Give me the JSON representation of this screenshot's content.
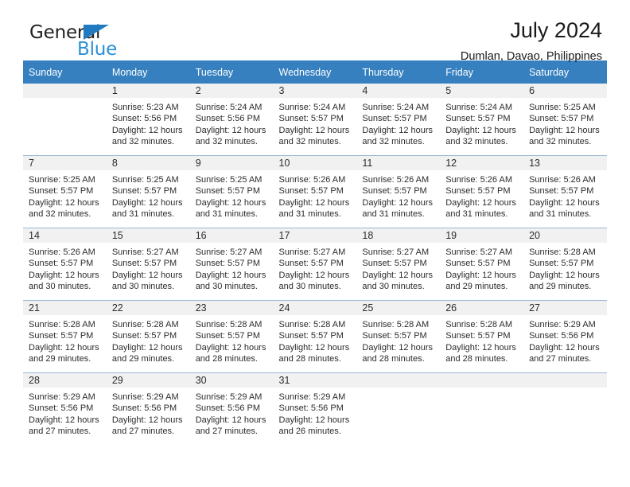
{
  "brand": {
    "name_part1": "General",
    "name_part2": "Blue",
    "triangle_color": "#1f7ac0",
    "text_color": "#2b8fd4"
  },
  "header": {
    "title": "July 2024",
    "subtitle": "Dumlan, Davao, Philippines"
  },
  "theme": {
    "header_bg": "#3680c0",
    "header_text": "#ffffff",
    "daynum_bg": "#f1f1f1",
    "row_divider": "#9cb8d3"
  },
  "weekday_headers": [
    "Sunday",
    "Monday",
    "Tuesday",
    "Wednesday",
    "Thursday",
    "Friday",
    "Saturday"
  ],
  "weeks": [
    [
      {
        "day": "",
        "sunrise": "",
        "sunset": "",
        "daylight_line1": "",
        "daylight_line2": ""
      },
      {
        "day": "1",
        "sunrise": "Sunrise: 5:23 AM",
        "sunset": "Sunset: 5:56 PM",
        "daylight_line1": "Daylight: 12 hours",
        "daylight_line2": "and 32 minutes."
      },
      {
        "day": "2",
        "sunrise": "Sunrise: 5:24 AM",
        "sunset": "Sunset: 5:56 PM",
        "daylight_line1": "Daylight: 12 hours",
        "daylight_line2": "and 32 minutes."
      },
      {
        "day": "3",
        "sunrise": "Sunrise: 5:24 AM",
        "sunset": "Sunset: 5:57 PM",
        "daylight_line1": "Daylight: 12 hours",
        "daylight_line2": "and 32 minutes."
      },
      {
        "day": "4",
        "sunrise": "Sunrise: 5:24 AM",
        "sunset": "Sunset: 5:57 PM",
        "daylight_line1": "Daylight: 12 hours",
        "daylight_line2": "and 32 minutes."
      },
      {
        "day": "5",
        "sunrise": "Sunrise: 5:24 AM",
        "sunset": "Sunset: 5:57 PM",
        "daylight_line1": "Daylight: 12 hours",
        "daylight_line2": "and 32 minutes."
      },
      {
        "day": "6",
        "sunrise": "Sunrise: 5:25 AM",
        "sunset": "Sunset: 5:57 PM",
        "daylight_line1": "Daylight: 12 hours",
        "daylight_line2": "and 32 minutes."
      }
    ],
    [
      {
        "day": "7",
        "sunrise": "Sunrise: 5:25 AM",
        "sunset": "Sunset: 5:57 PM",
        "daylight_line1": "Daylight: 12 hours",
        "daylight_line2": "and 32 minutes."
      },
      {
        "day": "8",
        "sunrise": "Sunrise: 5:25 AM",
        "sunset": "Sunset: 5:57 PM",
        "daylight_line1": "Daylight: 12 hours",
        "daylight_line2": "and 31 minutes."
      },
      {
        "day": "9",
        "sunrise": "Sunrise: 5:25 AM",
        "sunset": "Sunset: 5:57 PM",
        "daylight_line1": "Daylight: 12 hours",
        "daylight_line2": "and 31 minutes."
      },
      {
        "day": "10",
        "sunrise": "Sunrise: 5:26 AM",
        "sunset": "Sunset: 5:57 PM",
        "daylight_line1": "Daylight: 12 hours",
        "daylight_line2": "and 31 minutes."
      },
      {
        "day": "11",
        "sunrise": "Sunrise: 5:26 AM",
        "sunset": "Sunset: 5:57 PM",
        "daylight_line1": "Daylight: 12 hours",
        "daylight_line2": "and 31 minutes."
      },
      {
        "day": "12",
        "sunrise": "Sunrise: 5:26 AM",
        "sunset": "Sunset: 5:57 PM",
        "daylight_line1": "Daylight: 12 hours",
        "daylight_line2": "and 31 minutes."
      },
      {
        "day": "13",
        "sunrise": "Sunrise: 5:26 AM",
        "sunset": "Sunset: 5:57 PM",
        "daylight_line1": "Daylight: 12 hours",
        "daylight_line2": "and 31 minutes."
      }
    ],
    [
      {
        "day": "14",
        "sunrise": "Sunrise: 5:26 AM",
        "sunset": "Sunset: 5:57 PM",
        "daylight_line1": "Daylight: 12 hours",
        "daylight_line2": "and 30 minutes."
      },
      {
        "day": "15",
        "sunrise": "Sunrise: 5:27 AM",
        "sunset": "Sunset: 5:57 PM",
        "daylight_line1": "Daylight: 12 hours",
        "daylight_line2": "and 30 minutes."
      },
      {
        "day": "16",
        "sunrise": "Sunrise: 5:27 AM",
        "sunset": "Sunset: 5:57 PM",
        "daylight_line1": "Daylight: 12 hours",
        "daylight_line2": "and 30 minutes."
      },
      {
        "day": "17",
        "sunrise": "Sunrise: 5:27 AM",
        "sunset": "Sunset: 5:57 PM",
        "daylight_line1": "Daylight: 12 hours",
        "daylight_line2": "and 30 minutes."
      },
      {
        "day": "18",
        "sunrise": "Sunrise: 5:27 AM",
        "sunset": "Sunset: 5:57 PM",
        "daylight_line1": "Daylight: 12 hours",
        "daylight_line2": "and 30 minutes."
      },
      {
        "day": "19",
        "sunrise": "Sunrise: 5:27 AM",
        "sunset": "Sunset: 5:57 PM",
        "daylight_line1": "Daylight: 12 hours",
        "daylight_line2": "and 29 minutes."
      },
      {
        "day": "20",
        "sunrise": "Sunrise: 5:28 AM",
        "sunset": "Sunset: 5:57 PM",
        "daylight_line1": "Daylight: 12 hours",
        "daylight_line2": "and 29 minutes."
      }
    ],
    [
      {
        "day": "21",
        "sunrise": "Sunrise: 5:28 AM",
        "sunset": "Sunset: 5:57 PM",
        "daylight_line1": "Daylight: 12 hours",
        "daylight_line2": "and 29 minutes."
      },
      {
        "day": "22",
        "sunrise": "Sunrise: 5:28 AM",
        "sunset": "Sunset: 5:57 PM",
        "daylight_line1": "Daylight: 12 hours",
        "daylight_line2": "and 29 minutes."
      },
      {
        "day": "23",
        "sunrise": "Sunrise: 5:28 AM",
        "sunset": "Sunset: 5:57 PM",
        "daylight_line1": "Daylight: 12 hours",
        "daylight_line2": "and 28 minutes."
      },
      {
        "day": "24",
        "sunrise": "Sunrise: 5:28 AM",
        "sunset": "Sunset: 5:57 PM",
        "daylight_line1": "Daylight: 12 hours",
        "daylight_line2": "and 28 minutes."
      },
      {
        "day": "25",
        "sunrise": "Sunrise: 5:28 AM",
        "sunset": "Sunset: 5:57 PM",
        "daylight_line1": "Daylight: 12 hours",
        "daylight_line2": "and 28 minutes."
      },
      {
        "day": "26",
        "sunrise": "Sunrise: 5:28 AM",
        "sunset": "Sunset: 5:57 PM",
        "daylight_line1": "Daylight: 12 hours",
        "daylight_line2": "and 28 minutes."
      },
      {
        "day": "27",
        "sunrise": "Sunrise: 5:29 AM",
        "sunset": "Sunset: 5:56 PM",
        "daylight_line1": "Daylight: 12 hours",
        "daylight_line2": "and 27 minutes."
      }
    ],
    [
      {
        "day": "28",
        "sunrise": "Sunrise: 5:29 AM",
        "sunset": "Sunset: 5:56 PM",
        "daylight_line1": "Daylight: 12 hours",
        "daylight_line2": "and 27 minutes."
      },
      {
        "day": "29",
        "sunrise": "Sunrise: 5:29 AM",
        "sunset": "Sunset: 5:56 PM",
        "daylight_line1": "Daylight: 12 hours",
        "daylight_line2": "and 27 minutes."
      },
      {
        "day": "30",
        "sunrise": "Sunrise: 5:29 AM",
        "sunset": "Sunset: 5:56 PM",
        "daylight_line1": "Daylight: 12 hours",
        "daylight_line2": "and 27 minutes."
      },
      {
        "day": "31",
        "sunrise": "Sunrise: 5:29 AM",
        "sunset": "Sunset: 5:56 PM",
        "daylight_line1": "Daylight: 12 hours",
        "daylight_line2": "and 26 minutes."
      },
      {
        "day": "",
        "sunrise": "",
        "sunset": "",
        "daylight_line1": "",
        "daylight_line2": ""
      },
      {
        "day": "",
        "sunrise": "",
        "sunset": "",
        "daylight_line1": "",
        "daylight_line2": ""
      },
      {
        "day": "",
        "sunrise": "",
        "sunset": "",
        "daylight_line1": "",
        "daylight_line2": ""
      }
    ]
  ]
}
